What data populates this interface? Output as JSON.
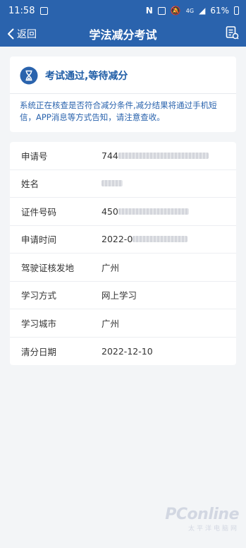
{
  "status_bar": {
    "time": "11:58",
    "battery": "61%",
    "network": "4G"
  },
  "nav": {
    "back_label": "返回",
    "title": "学法减分考试"
  },
  "status_card": {
    "title": "考试通过,等待减分",
    "message": "系统正在核查是否符合减分条件,减分结果将通过手机短信，APP消息等方式告知，请注意查收。"
  },
  "info": [
    {
      "label": "申请号",
      "value": "744"
    },
    {
      "label": "姓名",
      "value": ""
    },
    {
      "label": "证件号码",
      "value": "450"
    },
    {
      "label": "申请时间",
      "value": "2022-0"
    },
    {
      "label": "驾驶证核发地",
      "value": "广州"
    },
    {
      "label": "学习方式",
      "value": "网上学习"
    },
    {
      "label": "学习城市",
      "value": "广州"
    },
    {
      "label": "清分日期",
      "value": "2022-12-10"
    }
  ],
  "watermark": {
    "brand": "PConline",
    "sub": "太平洋电脑网"
  },
  "colors": {
    "primary": "#2a63ad",
    "background": "#f3f5f7"
  }
}
